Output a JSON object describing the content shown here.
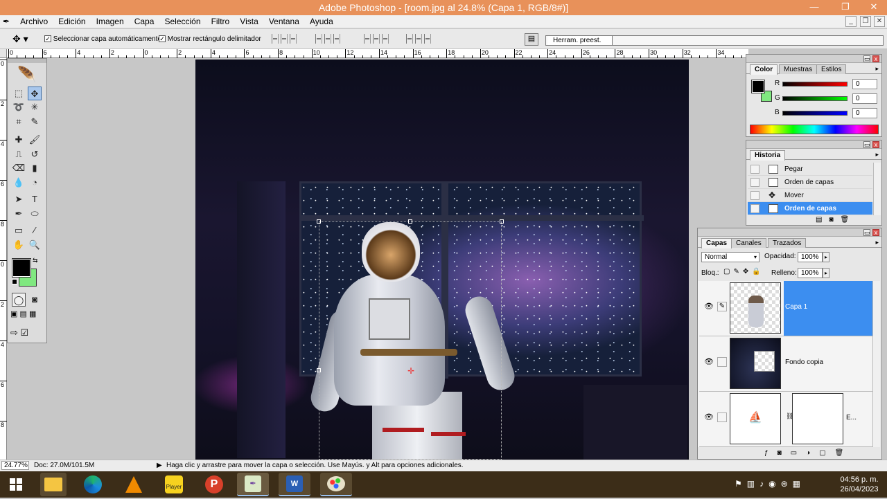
{
  "window": {
    "title": "Adobe Photoshop - [room.jpg al 24.8% (Capa 1, RGB/8#)]",
    "minimize": "—",
    "maximize": "❐",
    "close": "✕"
  },
  "menubar": {
    "items": [
      "Archivo",
      "Edición",
      "Imagen",
      "Capa",
      "Selección",
      "Filtro",
      "Vista",
      "Ventana",
      "Ayuda"
    ],
    "doc_controls": [
      "_",
      "❐",
      "✕"
    ]
  },
  "options_bar": {
    "tool_icon": "move-tool-icon",
    "auto_select_label": "Seleccionar capa automáticamente",
    "auto_select_checked": true,
    "show_bbox_label": "Mostrar rectángulo delimitador",
    "show_bbox_checked": true,
    "presets_label": "Herram. preest."
  },
  "rulers": {
    "horizontal": [
      "0",
      "6",
      "4",
      "2",
      "0",
      "2",
      "4",
      "6",
      "8",
      "10",
      "12",
      "14",
      "16",
      "18",
      "20",
      "22",
      "24",
      "26",
      "28",
      "30",
      "32",
      "34"
    ],
    "vertical": [
      "0",
      "2",
      "4",
      "6",
      "8",
      "0",
      "2",
      "4",
      "6",
      "8"
    ]
  },
  "canvas": {
    "file": "room.jpg",
    "zoom": "24.8%",
    "layer": "Capa 1",
    "mode": "RGB/8#"
  },
  "tools": {
    "foreground_color": "#000000",
    "background_color": "#80e880",
    "items": [
      "marquee-tool",
      "move-tool",
      "lasso-tool",
      "magic-wand-tool",
      "crop-tool",
      "slice-tool",
      "healing-brush-tool",
      "brush-tool",
      "clone-stamp-tool",
      "history-brush-tool",
      "eraser-tool",
      "gradient-tool",
      "blur-tool",
      "dodge-tool",
      "path-selection-tool",
      "type-tool",
      "pen-tool",
      "shape-tool",
      "notes-tool",
      "eyedropper-tool",
      "hand-tool",
      "zoom-tool"
    ]
  },
  "color_panel": {
    "tabs": [
      "Color",
      "Muestras",
      "Estilos"
    ],
    "active_tab": "Color",
    "channels": [
      {
        "label": "R",
        "value": "0",
        "color": "#d00000"
      },
      {
        "label": "G",
        "value": "0",
        "color": "#00b000"
      },
      {
        "label": "B",
        "value": "0",
        "color": "#0000d0"
      }
    ],
    "fg": "#000000",
    "bg": "#80e880"
  },
  "history_panel": {
    "tab": "Historia",
    "items": [
      {
        "label": "Pegar",
        "selected": false
      },
      {
        "label": "Orden de capas",
        "selected": false
      },
      {
        "label": "Mover",
        "selected": false
      },
      {
        "label": "Orden de capas",
        "selected": true
      }
    ]
  },
  "layers_panel": {
    "tabs": [
      "Capas",
      "Canales",
      "Trazados"
    ],
    "active_tab": "Capas",
    "blend_mode": "Normal",
    "opacity_label": "Opacidad:",
    "opacity": "100%",
    "lock_label": "Bloq.:",
    "fill_label": "Relleno:",
    "fill": "100%",
    "layers": [
      {
        "name": "Capa 1",
        "selected": true,
        "visible": true
      },
      {
        "name": "Fondo copia",
        "selected": false,
        "visible": true
      },
      {
        "name": "E...",
        "selected": false,
        "visible": true
      }
    ]
  },
  "status_bar": {
    "zoom": "24.77%",
    "doc": "Doc: 27.0M/101.5M",
    "hint": "Haga clic y arrastre para mover la capa o selección. Use Mayús. y Alt para opciones adicionales."
  },
  "taskbar": {
    "apps": [
      "windows-start",
      "file-explorer",
      "edge",
      "vlc",
      "player",
      "wps-presentation",
      "photoshop",
      "word",
      "paint"
    ],
    "player_label": "Player",
    "time": "04:56 p. m.",
    "date": "26/04/2023"
  }
}
